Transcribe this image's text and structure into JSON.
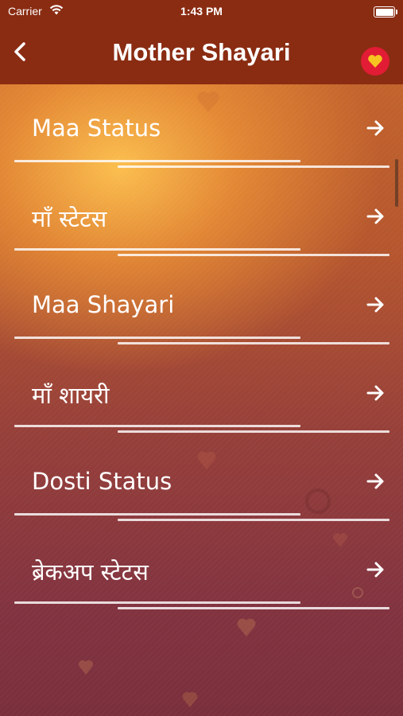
{
  "status_bar": {
    "carrier": "Carrier",
    "time": "1:43 PM"
  },
  "nav": {
    "title": "Mother Shayari",
    "back_icon": "chevron-left-icon",
    "favorite_icon": "heart-icon"
  },
  "menu": {
    "items": [
      {
        "label": "Maa Status"
      },
      {
        "label": "माँ स्टेटस"
      },
      {
        "label": "Maa Shayari"
      },
      {
        "label": "माँ शायरी"
      },
      {
        "label": "Dosti Status"
      },
      {
        "label": "ब्रेकअप स्टेटस"
      }
    ]
  },
  "colors": {
    "navbar": "#8a2c12",
    "favorite_badge": "#e11c34",
    "heart": "#f7c321"
  }
}
